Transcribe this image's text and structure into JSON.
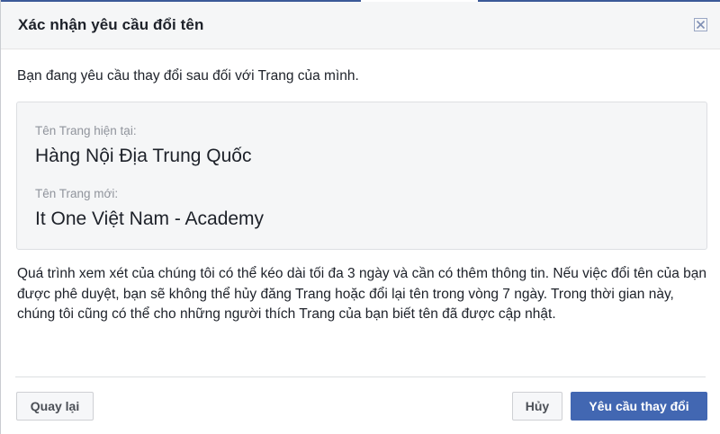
{
  "dialog": {
    "title": "Xác nhận yêu cầu đổi tên",
    "close_icon": "close-icon",
    "intro": "Bạn đang yêu cầu thay đổi sau đối với Trang của mình.",
    "current_name_label": "Tên Trang hiện tại:",
    "current_name": "Hàng Nội Địa Trung Quốc",
    "new_name_label": "Tên Trang mới:",
    "new_name": "It One Việt Nam - Academy",
    "description": "Quá trình xem xét của chúng tôi có thể kéo dài tối đa 3 ngày và cần có thêm thông tin. Nếu việc đổi tên của bạn được phê duyệt, bạn sẽ không thể hủy đăng Trang hoặc đổi lại tên trong vòng 7 ngày. Trong thời gian này, chúng tôi cũng có thể cho những người thích Trang của bạn biết tên đã được cập nhật."
  },
  "buttons": {
    "back": "Quay lại",
    "cancel": "Hủy",
    "request_change": "Yêu cầu thay đổi"
  },
  "colors": {
    "primary": "#4267b2",
    "header_bg": "#f5f6f7",
    "text": "#1d2129",
    "muted": "#90949c"
  }
}
